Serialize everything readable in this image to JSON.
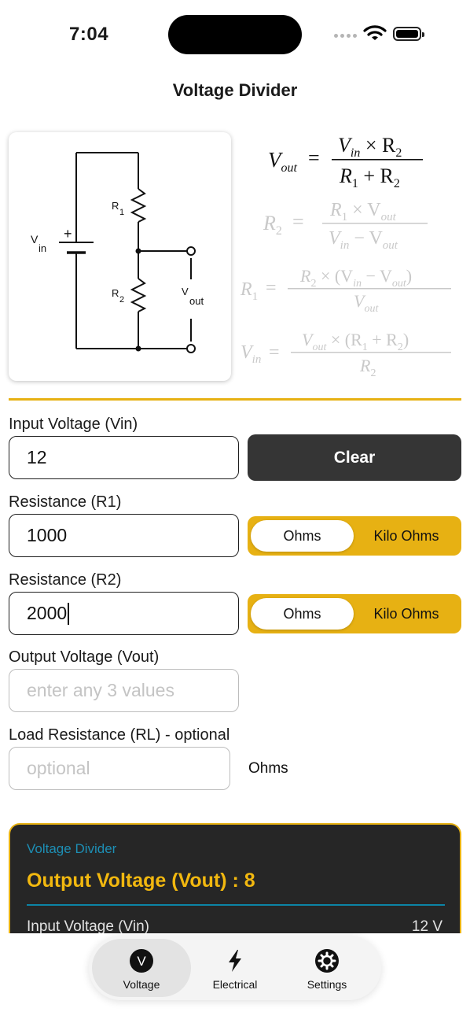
{
  "status_bar": {
    "time": "7:04"
  },
  "nav": {
    "title": "Voltage Divider"
  },
  "diagram": {
    "vin_label": "V",
    "vin_sub": "in",
    "r1_label": "R",
    "r1_sub": "1",
    "r2_label": "R",
    "r2_sub": "2",
    "vout_label": "V",
    "vout_sub": "out",
    "plus": "+"
  },
  "formulas": {
    "vout": {
      "lhs": "V",
      "lhs_sub": "out",
      "num": "V",
      "num_sub": "in",
      "num_mid": " × R",
      "num_sub2": "2",
      "den": "R",
      "den_sub": "1",
      "den_mid": " + R",
      "den_sub2": "2"
    },
    "r2": {
      "lhs": "R",
      "lhs_sub": "2",
      "num": "R",
      "num_sub": "1",
      "num_mid": " × V",
      "num_sub2": "out",
      "den": "V",
      "den_sub": "in",
      "den_mid": " − V",
      "den_sub2": "out"
    },
    "r1": {
      "lhs": "R",
      "lhs_sub": "1",
      "num": "R",
      "num_sub": "2",
      "num_mid": " × (V",
      "num_sub2": "in",
      "num_mid2": " − V",
      "num_sub3": "out",
      "num_end": ")",
      "den": "V",
      "den_sub": "out"
    },
    "vin": {
      "lhs": "V",
      "lhs_sub": "in",
      "num": "V",
      "num_sub": "out",
      "num_mid": " × (R",
      "num_sub2": "1",
      "num_mid2": " + R",
      "num_sub3": "2",
      "num_end": ")",
      "den": "R",
      "den_sub": "2"
    }
  },
  "form": {
    "vin": {
      "label": "Input Voltage (Vin)",
      "value": "12"
    },
    "clear_label": "Clear",
    "r1": {
      "label": "Resistance (R1)",
      "value": "1000",
      "unit_selected": "Ohms",
      "unit_other": "Kilo Ohms"
    },
    "r2": {
      "label": "Resistance (R2)",
      "value": "2000",
      "unit_selected": "Ohms",
      "unit_other": "Kilo Ohms"
    },
    "vout": {
      "label": "Output Voltage (Vout)",
      "placeholder": "enter any 3 values"
    },
    "rl": {
      "label": "Load Resistance (RL) - optional",
      "placeholder": "optional",
      "unit": "Ohms"
    }
  },
  "result": {
    "section_title": "Voltage Divider",
    "main": "Output Voltage (Vout) : 8",
    "rows": [
      {
        "label": "Input Voltage (Vin)",
        "value": "12 V"
      }
    ]
  },
  "tabs": [
    {
      "label": "Voltage",
      "icon": "v-circle-icon",
      "active": true
    },
    {
      "label": "Electrical",
      "icon": "bolt-icon",
      "active": false
    },
    {
      "label": "Settings",
      "icon": "gear-icon",
      "active": false
    }
  ],
  "colors": {
    "accent": "#e7b113",
    "dark": "#353535",
    "result_bg": "#262626",
    "result_title": "#1d8fb5",
    "result_value": "#f2b80f"
  }
}
